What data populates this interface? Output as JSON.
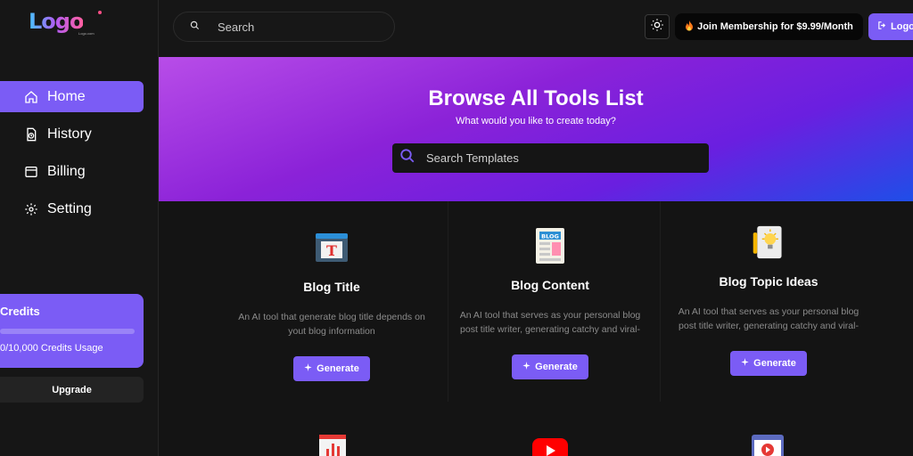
{
  "app": {
    "logo_text": "Logo",
    "logo_sub": "Logo.com"
  },
  "sidebar": {
    "items": [
      {
        "label": "Home",
        "active": true,
        "icon": "home-icon"
      },
      {
        "label": "History",
        "active": false,
        "icon": "history-icon"
      },
      {
        "label": "Billing",
        "active": false,
        "icon": "billing-icon"
      },
      {
        "label": "Setting",
        "active": false,
        "icon": "gear-icon"
      }
    ],
    "credits": {
      "title": "Credits",
      "usage": "0/10,000 Credits Usage",
      "used_fraction": 0.0
    },
    "upgrade_label": "Upgrade"
  },
  "header": {
    "search_placeholder": "Search",
    "membership_label": "Join Membership for $9.99/Month",
    "logout_label": "Logout"
  },
  "banner": {
    "title": "Browse All Tools List",
    "subtitle": "What would you like to create today?",
    "search_placeholder": "Search Templates"
  },
  "cards": [
    {
      "title": "Blog Title",
      "description": "An AI tool that generate blog title depends on yout blog information",
      "button": "Generate",
      "icon": "blog-title-icon"
    },
    {
      "title": "Blog Content",
      "description": "An AI tool that serves as your personal blog post title writer, generating catchy and viral-worthy titles in your chosen language.",
      "button": "Generate",
      "icon": "blog-content-icon"
    },
    {
      "title": "Blog Topic Ideas",
      "description": "An AI tool that serves as your personal blog post title writer, generating catchy and viral-worthy titles in your chosen language.",
      "button": "Generate",
      "icon": "lightbulb-idea-icon"
    }
  ],
  "colors": {
    "accent": "#7b5cf5",
    "background": "#141414"
  }
}
